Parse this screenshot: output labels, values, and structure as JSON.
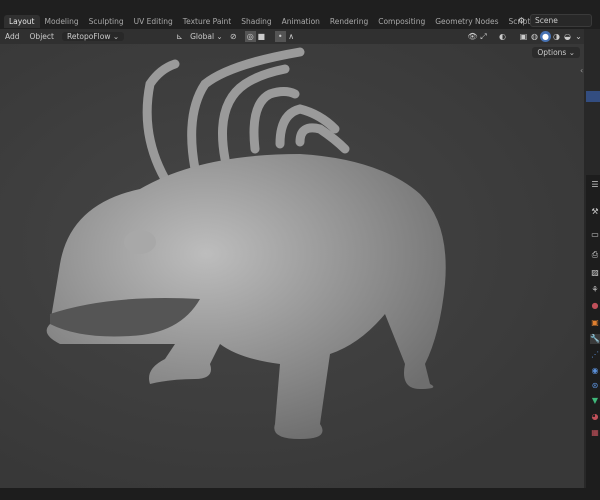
{
  "workspace_tabs": [
    "Layout",
    "Modeling",
    "Sculpting",
    "UV Editing",
    "Texture Paint",
    "Shading",
    "Animation",
    "Rendering",
    "Compositing",
    "Geometry Nodes",
    "Scripting"
  ],
  "active_tab": "Layout",
  "add_tab": "+",
  "scene": {
    "label": "Scene"
  },
  "header": {
    "add": "Add",
    "object": "Object",
    "addon": "RetopoFlow ⌄",
    "orientation": "Global ⌄",
    "options": "Options ⌄"
  },
  "colors": {
    "accent": "#4772b3",
    "selection": "#334d80"
  }
}
